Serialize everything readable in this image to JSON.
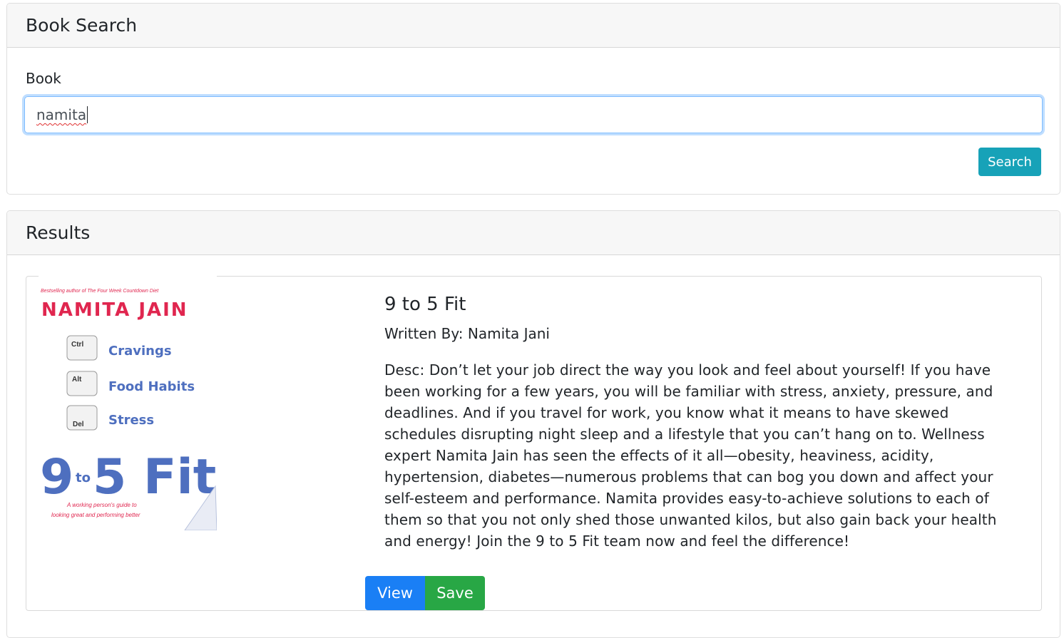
{
  "search_card": {
    "header": "Book Search",
    "field_label": "Book",
    "input_value": "namita",
    "search_label": "Search"
  },
  "results_card": {
    "header": "Results",
    "items": [
      {
        "title": "9 to 5 Fit",
        "author": "Written By: Namita Jani",
        "description": "Desc: Don’t let your job direct the way you look and feel about yourself! If you have been working for a few years, you will be familiar with stress, anxiety, pressure, and deadlines. And if you travel for work, you know what it means to have skewed schedules disrupting night sleep and a lifestyle that you can’t hang on to. Wellness expert Namita Jain has seen the effects of it all—obesity, heaviness, acidity, hypertension, diabetes—numerous problems that can bog you down and affect your self-esteem and performance. Namita provides easy-to-achieve solutions to each of them so that you not only shed those unwanted kilos, but also gain back your health and energy! Join the 9 to 5 Fit team now and feel the difference!",
        "view_label": "View",
        "save_label": "Save",
        "cover": {
          "tagline": "Bestselling author of The Four Week Countdown Diet",
          "author_name": "NAMITA JAIN",
          "keys": [
            {
              "key": "Ctrl",
              "text": "Cravings"
            },
            {
              "key": "Alt",
              "text": "Food Habits"
            },
            {
              "key": "Del",
              "text": "Stress"
            }
          ],
          "big_left": "9",
          "big_to": "to",
          "big_right": "5 Fit",
          "subtitle_1": "A working person's guide to",
          "subtitle_2": "looking great and performing better"
        }
      }
    ]
  },
  "colors": {
    "accent_info": "#17a2b8",
    "primary": "#1a7ff5",
    "success": "#28a745",
    "cover_red": "#e0264f",
    "cover_blue": "#4e6fbf"
  }
}
